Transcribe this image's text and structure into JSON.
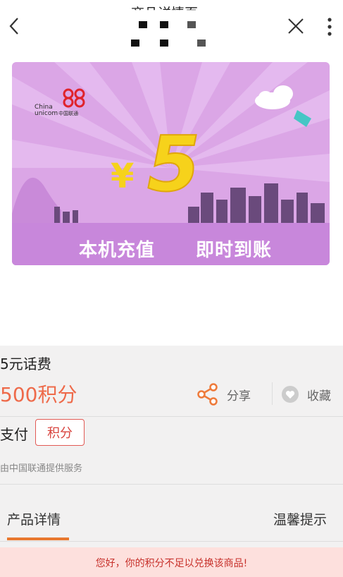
{
  "header": {
    "title": "商品详情页",
    "back_icon": "chevron-left-icon",
    "close_icon": "close-icon",
    "more_icon": "more-vertical-icon"
  },
  "banner": {
    "brand_en": "China unicom",
    "brand_cn": "中国联通",
    "currency": "¥",
    "amount": "5",
    "text_left": "本机充值",
    "text_right": "即时到账",
    "colors": {
      "bg": "#dba6e6",
      "accent": "#f6d21b",
      "city": "#6a4a7c"
    }
  },
  "product": {
    "name": "5元话费",
    "points": "500积分",
    "share_label": "分享",
    "favorite_label": "收藏",
    "pay_label": "支付",
    "pay_method_badge": "积分",
    "provider": "由中国联通提供服务"
  },
  "tabs": [
    {
      "label": "产品详情",
      "active": true
    },
    {
      "label": "温馨提示",
      "active": false
    }
  ],
  "notice": {
    "text": "您好，你的积分不足以兑换该商品!"
  },
  "colors": {
    "points": "#ee6a4a",
    "badge_border": "#e25a55",
    "tab_indicator": "#e8782f",
    "notice_bg": "#fde0dd",
    "notice_text": "#c7302a"
  }
}
